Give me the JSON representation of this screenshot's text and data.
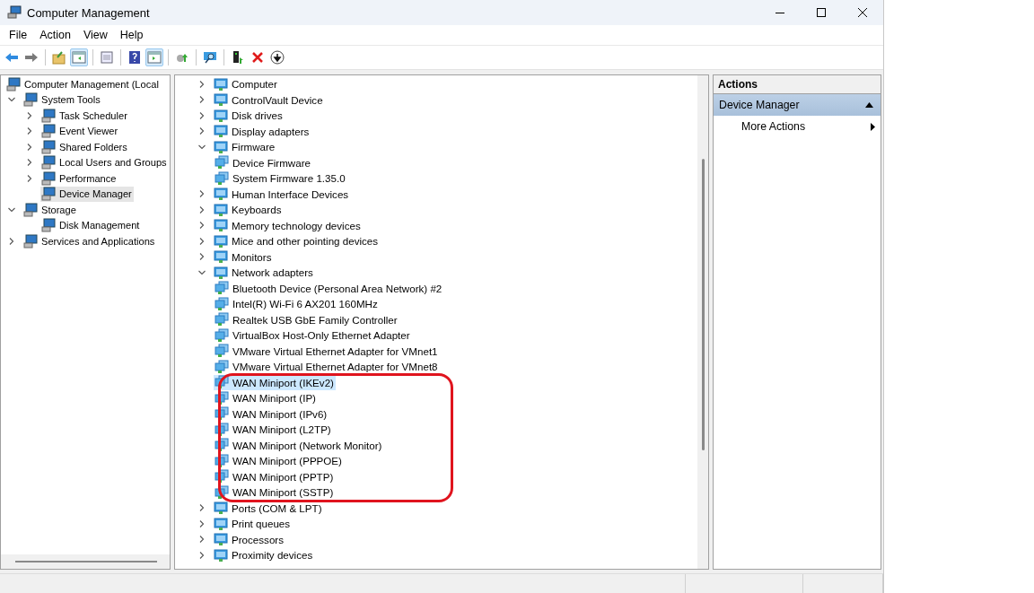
{
  "window": {
    "title": "Computer Management"
  },
  "menu": [
    "File",
    "Action",
    "View",
    "Help"
  ],
  "toolbar": [
    {
      "kind": "button",
      "pressed": false
    },
    {
      "kind": "button",
      "pressed": false
    },
    {
      "kind": "separator"
    },
    {
      "kind": "button",
      "pressed": false
    },
    {
      "kind": "button",
      "pressed": true
    },
    {
      "kind": "separator"
    },
    {
      "kind": "button",
      "pressed": false
    },
    {
      "kind": "separator"
    },
    {
      "kind": "button",
      "pressed": false
    },
    {
      "kind": "button",
      "pressed": true
    },
    {
      "kind": "separator"
    },
    {
      "kind": "button",
      "pressed": false
    },
    {
      "kind": "separator"
    },
    {
      "kind": "button",
      "pressed": false
    },
    {
      "kind": "separator"
    },
    {
      "kind": "button",
      "pressed": false
    },
    {
      "kind": "button",
      "pressed": false
    },
    {
      "kind": "button",
      "pressed": false
    }
  ],
  "console_tree": {
    "items": [
      {
        "label": "Computer Management (Local",
        "selected": false,
        "children": [
          {
            "label": "System Tools",
            "expanded": true,
            "selected": false,
            "children": [
              {
                "label": "Task Scheduler",
                "expanded": false,
                "selected": false
              },
              {
                "label": "Event Viewer",
                "expanded": false,
                "selected": false
              },
              {
                "label": "Shared Folders",
                "expanded": false,
                "selected": false
              },
              {
                "label": "Local Users and Groups",
                "expanded": false,
                "selected": false
              },
              {
                "label": "Performance",
                "expanded": false,
                "selected": false
              },
              {
                "label": "Device Manager",
                "selected": true
              }
            ]
          },
          {
            "label": "Storage",
            "expanded": true,
            "selected": false,
            "children": [
              {
                "label": "Disk Management",
                "selected": false
              }
            ]
          },
          {
            "label": "Services and Applications",
            "expanded": false,
            "selected": false
          }
        ]
      }
    ]
  },
  "device_tree": {
    "items": [
      {
        "label": "Computer",
        "expanded": false,
        "selected": false
      },
      {
        "label": "ControlVault Device",
        "expanded": false,
        "selected": false
      },
      {
        "label": "Disk drives",
        "expanded": false,
        "selected": false
      },
      {
        "label": "Display adapters",
        "expanded": false,
        "selected": false
      },
      {
        "label": "Firmware",
        "expanded": true,
        "selected": false,
        "children": [
          {
            "label": "Device Firmware",
            "selected": false
          },
          {
            "label": "System Firmware 1.35.0",
            "selected": false
          }
        ]
      },
      {
        "label": "Human Interface Devices",
        "expanded": false,
        "selected": false
      },
      {
        "label": "Keyboards",
        "expanded": false,
        "selected": false
      },
      {
        "label": "Memory technology devices",
        "expanded": false,
        "selected": false
      },
      {
        "label": "Mice and other pointing devices",
        "expanded": false,
        "selected": false
      },
      {
        "label": "Monitors",
        "expanded": false,
        "selected": false
      },
      {
        "label": "Network adapters",
        "expanded": true,
        "selected": false,
        "children": [
          {
            "label": "Bluetooth Device (Personal Area Network) #2",
            "selected": false,
            "circled": false
          },
          {
            "label": "Intel(R) Wi-Fi 6 AX201 160MHz",
            "selected": false,
            "circled": false
          },
          {
            "label": "Realtek USB GbE Family Controller",
            "selected": false,
            "circled": false
          },
          {
            "label": "VirtualBox Host-Only Ethernet Adapter",
            "selected": false,
            "circled": false
          },
          {
            "label": "VMware Virtual Ethernet Adapter for VMnet1",
            "selected": false,
            "circled": false
          },
          {
            "label": "VMware Virtual Ethernet Adapter for VMnet8",
            "selected": false,
            "circled": false
          },
          {
            "label": "WAN Miniport (IKEv2)",
            "selected": true,
            "circled": true
          },
          {
            "label": "WAN Miniport (IP)",
            "selected": false,
            "circled": true
          },
          {
            "label": "WAN Miniport (IPv6)",
            "selected": false,
            "circled": true
          },
          {
            "label": "WAN Miniport (L2TP)",
            "selected": false,
            "circled": true
          },
          {
            "label": "WAN Miniport (Network Monitor)",
            "selected": false,
            "circled": true
          },
          {
            "label": "WAN Miniport (PPPOE)",
            "selected": false,
            "circled": true
          },
          {
            "label": "WAN Miniport (PPTP)",
            "selected": false,
            "circled": true
          },
          {
            "label": "WAN Miniport (SSTP)",
            "selected": false,
            "circled": true
          }
        ]
      },
      {
        "label": "Ports (COM & LPT)",
        "expanded": false,
        "selected": false
      },
      {
        "label": "Print queues",
        "expanded": false,
        "selected": false
      },
      {
        "label": "Processors",
        "expanded": false,
        "selected": false
      },
      {
        "label": "Proximity devices",
        "expanded": false,
        "selected": false
      }
    ]
  },
  "actions": {
    "title": "Actions",
    "section": {
      "label": "Device Manager",
      "expanded": true
    },
    "items": [
      {
        "label": "More Actions"
      }
    ]
  }
}
